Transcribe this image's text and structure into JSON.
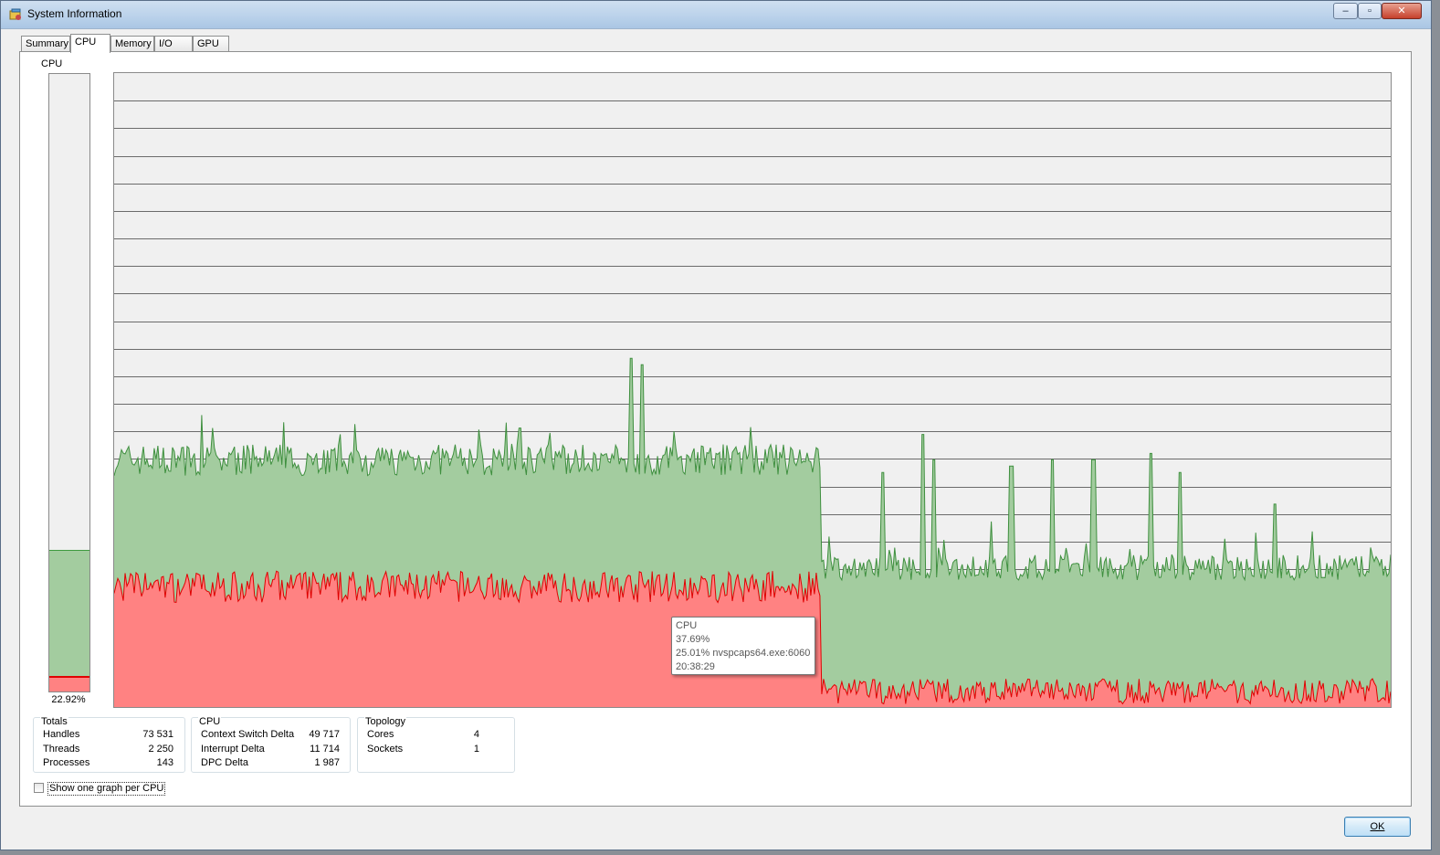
{
  "window": {
    "title": "System Information",
    "controls": {
      "minimize": "‒",
      "maximize": "▫",
      "close": "✕"
    }
  },
  "tabs": [
    {
      "label": "Summary",
      "active": false
    },
    {
      "label": "CPU",
      "active": true
    },
    {
      "label": "Memory",
      "active": false
    },
    {
      "label": "I/O",
      "active": false
    },
    {
      "label": "GPU",
      "active": false
    }
  ],
  "meter": {
    "label": "CPU",
    "value_text": "22.92%",
    "total_fraction": 0.2292,
    "kernel_fraction": 0.025
  },
  "tooltip": {
    "title": "CPU",
    "total": "37.69%",
    "process": "25.01% nvspcaps64.exe:6060",
    "time": "20:38:29"
  },
  "totals": {
    "title": "Totals",
    "rows": [
      {
        "label": "Handles",
        "value": "73 531"
      },
      {
        "label": "Threads",
        "value": "2 250"
      },
      {
        "label": "Processes",
        "value": "143"
      }
    ]
  },
  "cpu_stats": {
    "title": "CPU",
    "rows": [
      {
        "label": "Context Switch Delta",
        "value": "49 717"
      },
      {
        "label": "Interrupt Delta",
        "value": "11 714"
      },
      {
        "label": "DPC Delta",
        "value": "1 987"
      }
    ]
  },
  "topology": {
    "title": "Topology",
    "rows": [
      {
        "label": "Cores",
        "value": "4"
      },
      {
        "label": "Sockets",
        "value": "1"
      }
    ]
  },
  "options": {
    "one_graph_per_cpu_label": "Show one graph per CPU",
    "one_graph_per_cpu_checked": false
  },
  "buttons": {
    "ok_label": "OK"
  },
  "colors": {
    "total_fill": "#a3cc9f",
    "total_line": "#3e8f3e",
    "kernel_fill": "#ff8282",
    "kernel_line": "#e00000",
    "grid": "#6b6b6b",
    "graph_bg": "#f0f0f0"
  },
  "chart_data": {
    "type": "area",
    "ylim": [
      0,
      100
    ],
    "grid": true,
    "gridlines": 23,
    "series": [],
    "segments": [
      {
        "from": 0.0,
        "to": 0.553,
        "total": 39,
        "total_noise": 2.5,
        "kernel": 19,
        "kernel_noise": 2.5
      },
      {
        "from": 0.553,
        "to": 1.0,
        "total": 22,
        "total_noise": 2.0,
        "kernel": 2.5,
        "kernel_noise": 2.0
      }
    ],
    "spikes": [
      {
        "at": 0.318,
        "total": 44
      },
      {
        "at": 0.405,
        "total": 55
      },
      {
        "at": 0.414,
        "total": 54
      },
      {
        "at": 0.602,
        "total": 37
      },
      {
        "at": 0.634,
        "total": 43
      },
      {
        "at": 0.642,
        "total": 39
      },
      {
        "at": 0.703,
        "total": 38
      },
      {
        "at": 0.735,
        "total": 39
      },
      {
        "at": 0.767,
        "total": 39
      },
      {
        "at": 0.812,
        "total": 40
      },
      {
        "at": 0.835,
        "total": 37
      },
      {
        "at": 0.909,
        "total": 32
      }
    ]
  }
}
